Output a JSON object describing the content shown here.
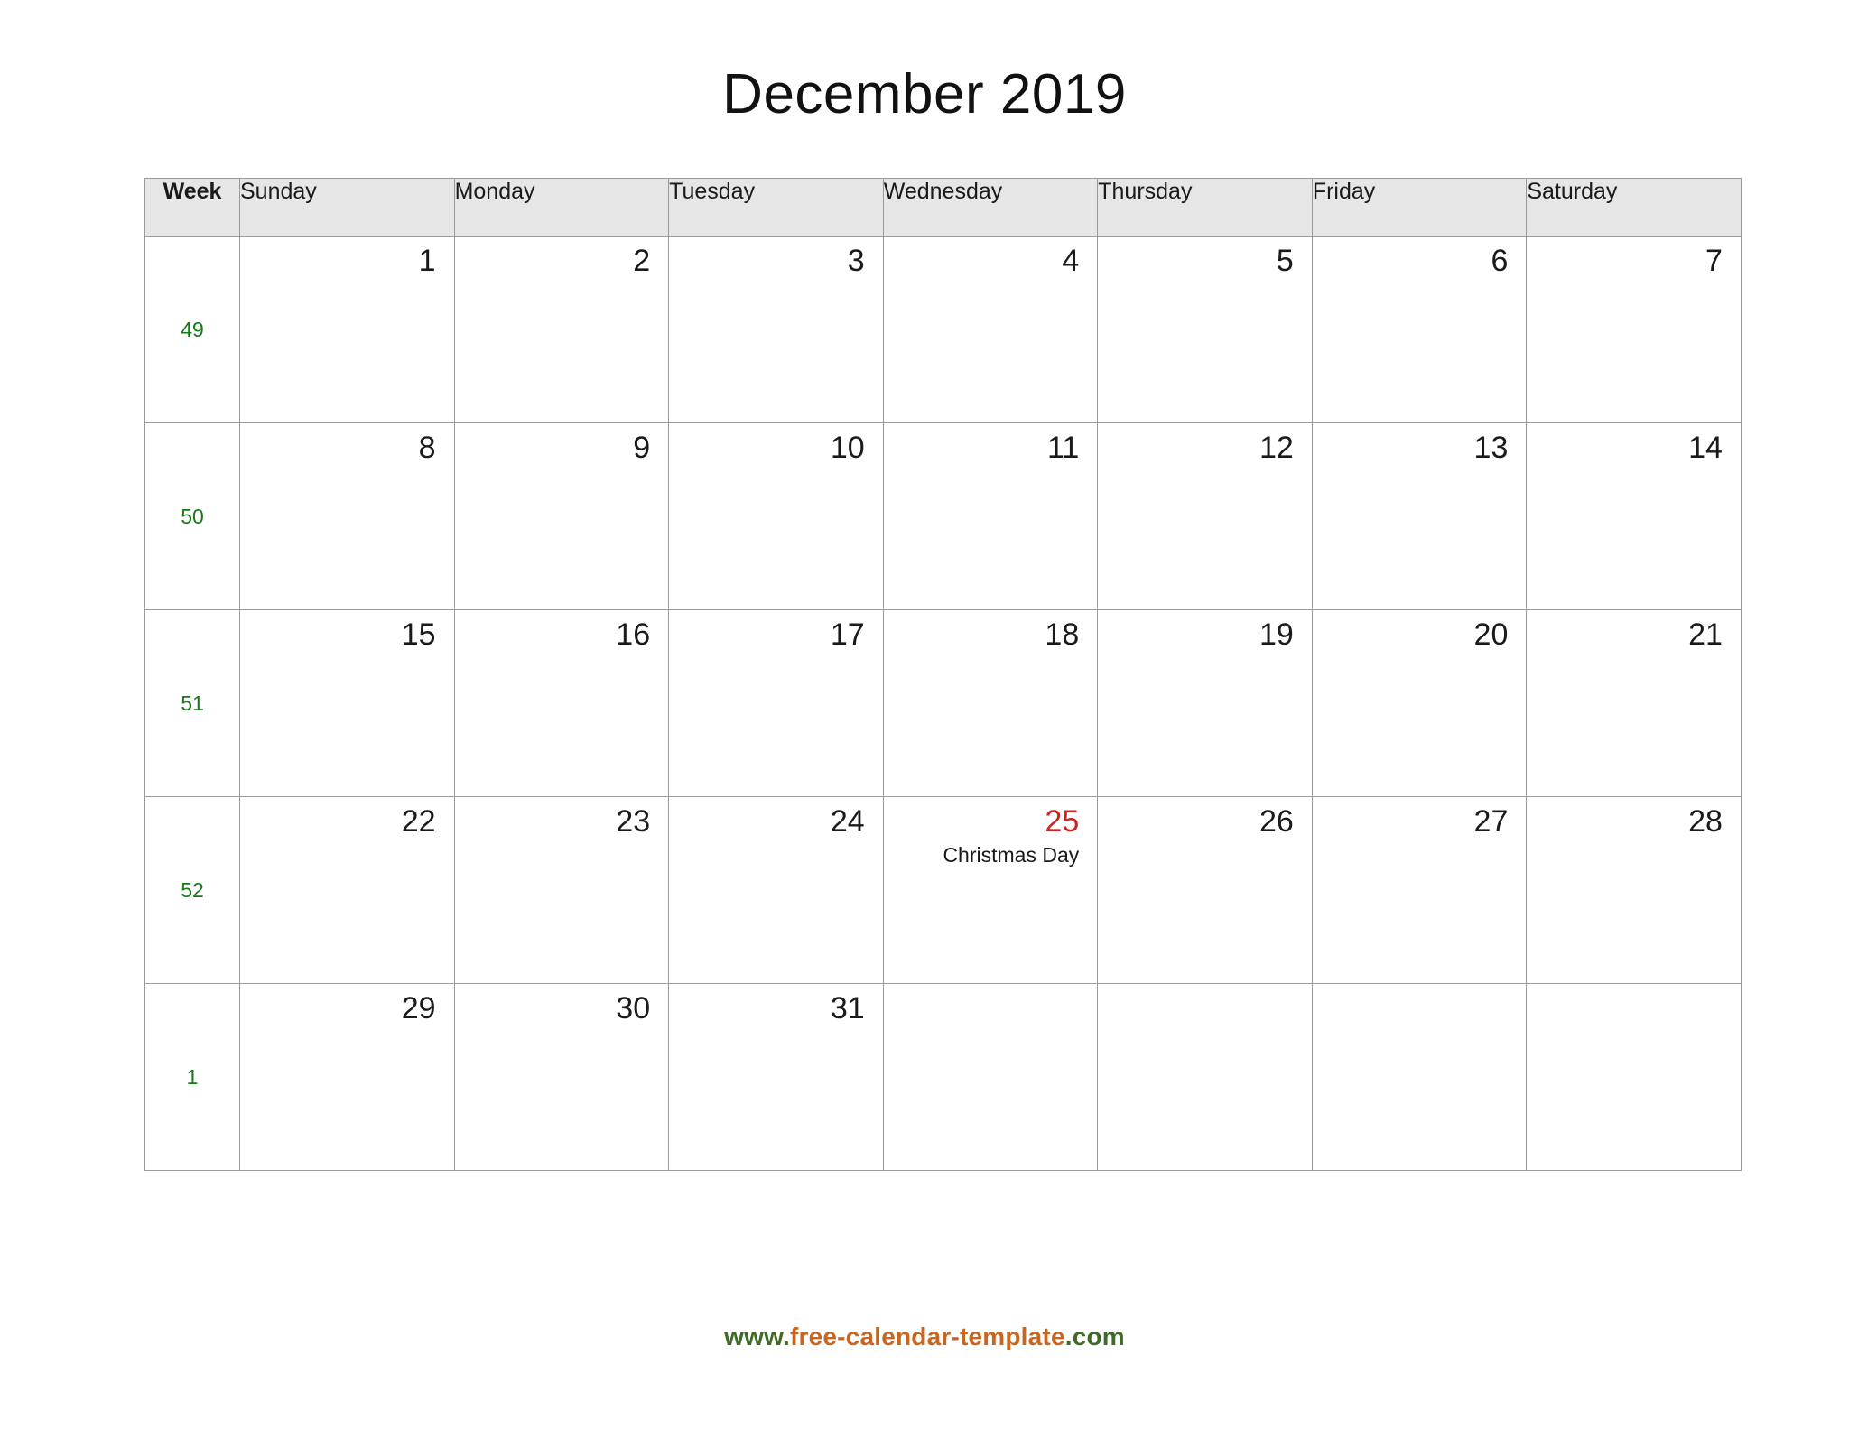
{
  "title": "December 2019",
  "colors": {
    "week_number": "#177a17",
    "holiday": "#cc2222",
    "header_bg": "#e6e6e6",
    "grid_line": "#9a9a9a",
    "footer_green": "#3f6b27",
    "footer_orange": "#c8651f"
  },
  "header": {
    "week_label": "Week",
    "days": [
      "Sunday",
      "Monday",
      "Tuesday",
      "Wednesday",
      "Thursday",
      "Friday",
      "Saturday"
    ]
  },
  "weeks": [
    {
      "week_number": "49",
      "days": [
        {
          "number": "1",
          "event": "",
          "holiday": false
        },
        {
          "number": "2",
          "event": "",
          "holiday": false
        },
        {
          "number": "3",
          "event": "",
          "holiday": false
        },
        {
          "number": "4",
          "event": "",
          "holiday": false
        },
        {
          "number": "5",
          "event": "",
          "holiday": false
        },
        {
          "number": "6",
          "event": "",
          "holiday": false
        },
        {
          "number": "7",
          "event": "",
          "holiday": false
        }
      ]
    },
    {
      "week_number": "50",
      "days": [
        {
          "number": "8",
          "event": "",
          "holiday": false
        },
        {
          "number": "9",
          "event": "",
          "holiday": false
        },
        {
          "number": "10",
          "event": "",
          "holiday": false
        },
        {
          "number": "11",
          "event": "",
          "holiday": false
        },
        {
          "number": "12",
          "event": "",
          "holiday": false
        },
        {
          "number": "13",
          "event": "",
          "holiday": false
        },
        {
          "number": "14",
          "event": "",
          "holiday": false
        }
      ]
    },
    {
      "week_number": "51",
      "days": [
        {
          "number": "15",
          "event": "",
          "holiday": false
        },
        {
          "number": "16",
          "event": "",
          "holiday": false
        },
        {
          "number": "17",
          "event": "",
          "holiday": false
        },
        {
          "number": "18",
          "event": "",
          "holiday": false
        },
        {
          "number": "19",
          "event": "",
          "holiday": false
        },
        {
          "number": "20",
          "event": "",
          "holiday": false
        },
        {
          "number": "21",
          "event": "",
          "holiday": false
        }
      ]
    },
    {
      "week_number": "52",
      "days": [
        {
          "number": "22",
          "event": "",
          "holiday": false
        },
        {
          "number": "23",
          "event": "",
          "holiday": false
        },
        {
          "number": "24",
          "event": "",
          "holiday": false
        },
        {
          "number": "25",
          "event": "Christmas Day",
          "holiday": true
        },
        {
          "number": "26",
          "event": "",
          "holiday": false
        },
        {
          "number": "27",
          "event": "",
          "holiday": false
        },
        {
          "number": "28",
          "event": "",
          "holiday": false
        }
      ]
    },
    {
      "week_number": "1",
      "days": [
        {
          "number": "29",
          "event": "",
          "holiday": false
        },
        {
          "number": "30",
          "event": "",
          "holiday": false
        },
        {
          "number": "31",
          "event": "",
          "holiday": false
        },
        {
          "number": "",
          "event": "",
          "holiday": false
        },
        {
          "number": "",
          "event": "",
          "holiday": false
        },
        {
          "number": "",
          "event": "",
          "holiday": false
        },
        {
          "number": "",
          "event": "",
          "holiday": false
        }
      ]
    }
  ],
  "footer": {
    "prefix": "www.",
    "middle": "free-calendar-template",
    "suffix": ".com",
    "full": "www.free-calendar-template.com"
  }
}
